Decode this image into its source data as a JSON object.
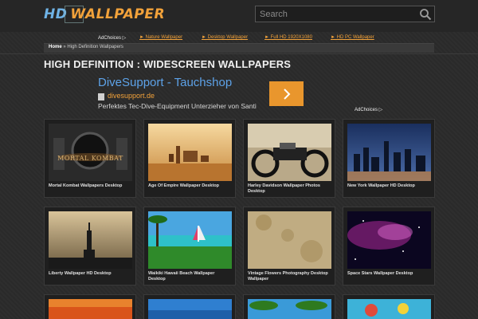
{
  "header": {
    "logo_hd": "HD",
    "logo_wallpaper": "WALLPAPER",
    "search_placeholder": "Search"
  },
  "nav": {
    "adchoices": "AdChoices ▷",
    "links": [
      {
        "label": "► Nature Wallpaper"
      },
      {
        "label": "► Desktop Wallpaper"
      },
      {
        "label": "► Full HD 1920X1080"
      },
      {
        "label": "► HD PC Wallpaper"
      }
    ]
  },
  "breadcrumb": {
    "home": "Home",
    "separator": " » ",
    "current": "High Definition Wallpapers"
  },
  "page_title": "HIGH DEFINITION : WIDESCREEN WALLPAPERS",
  "ad": {
    "title": "DiveSupport - Tauchshop",
    "domain": "divesupport.de",
    "description": "Perfektes Tec-Dive-Equipment Unterzieher von Santi",
    "adchoices": "AdChoices ▷",
    "button_icon": "chevron-right-icon"
  },
  "colors": {
    "accent_orange": "#f2a23a",
    "link_blue": "#5da2e8",
    "background": "#2b2b2b"
  },
  "wallpapers": [
    {
      "title": "Mortal Kombat Wallpapers Desktop",
      "thumb_text": "MORTAL KOMBAT"
    },
    {
      "title": "Age Of Empire Wallpaper Desktop"
    },
    {
      "title": "Harley Davidson Wallpaper Photos Desktop"
    },
    {
      "title": "New York Wallpaper HD Desktop"
    },
    {
      "title": "Liberty Wallpaper HD Desktop"
    },
    {
      "title": "Waikiki Hawaii Beach Wallpaper Desktop"
    },
    {
      "title": "Vintage Flowers Photography Desktop Wallpaper"
    },
    {
      "title": "Space Stars Wallpaper Desktop"
    }
  ]
}
